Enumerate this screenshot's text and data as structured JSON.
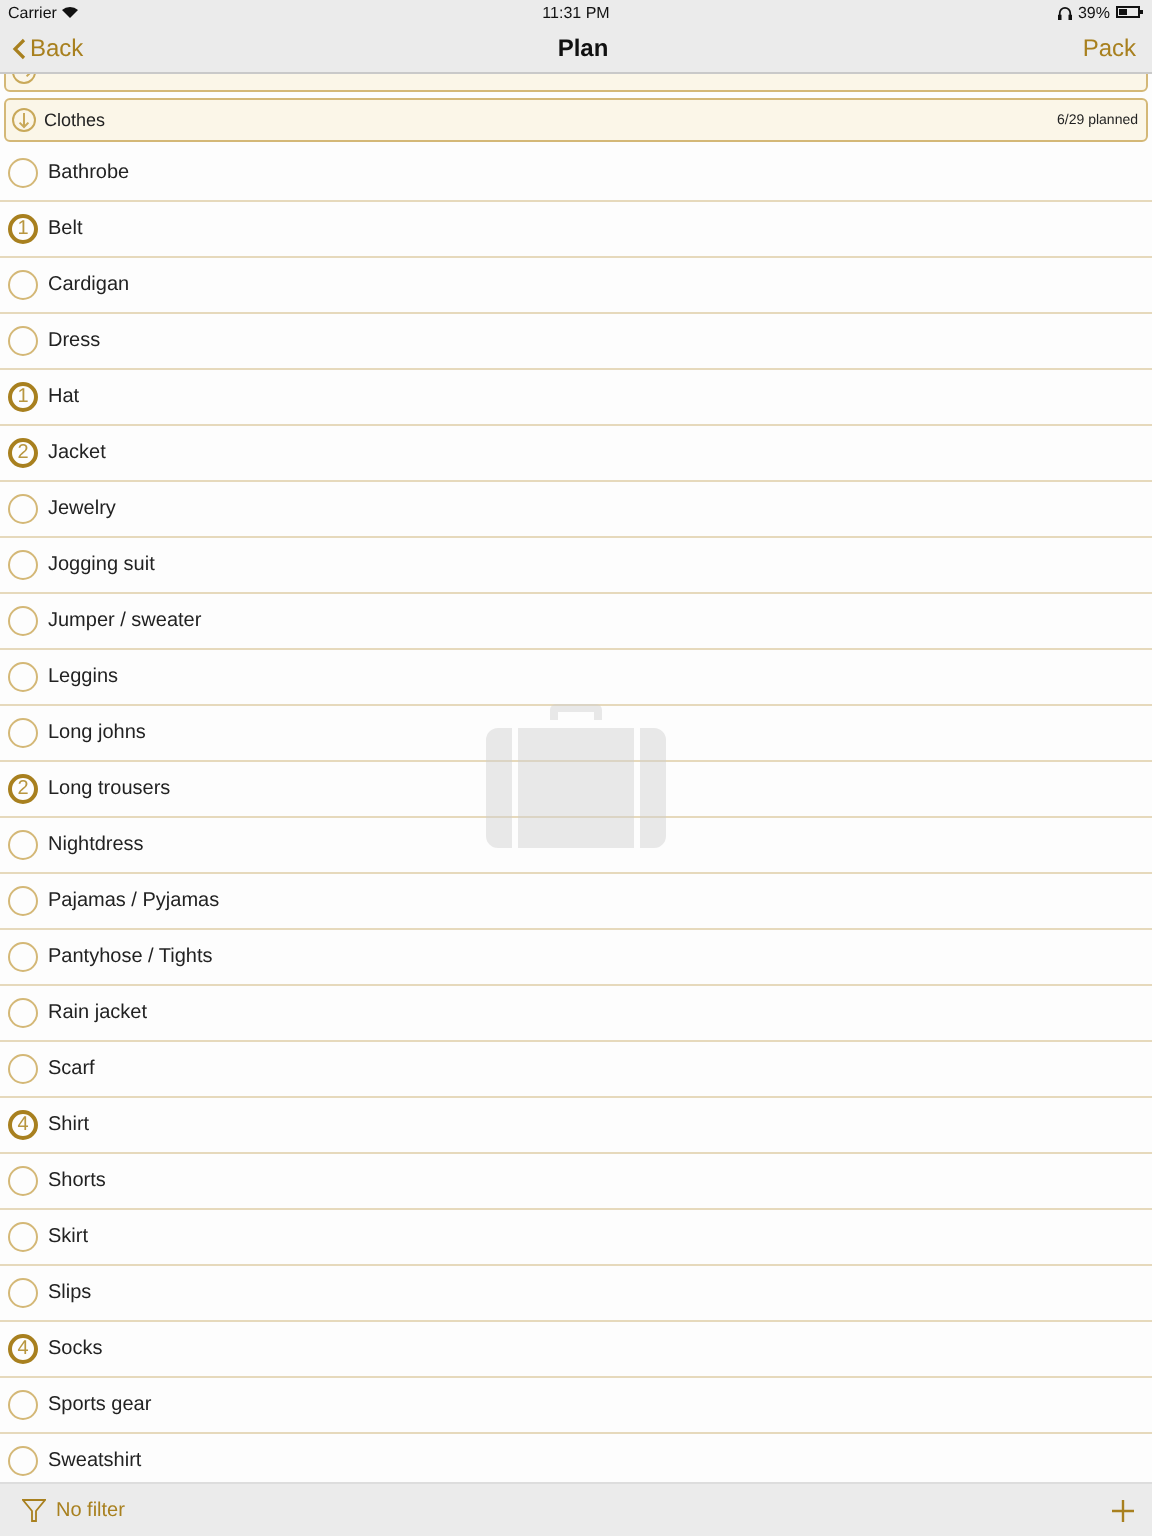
{
  "status_bar": {
    "carrier": "Carrier",
    "time": "11:31 PM",
    "battery": "39%"
  },
  "nav": {
    "back": "Back",
    "title": "Plan",
    "action": "Pack"
  },
  "sections": [
    {
      "expanded": false
    },
    {
      "title": "Clothes",
      "expanded": true,
      "summary": "6/29 planned"
    }
  ],
  "items": [
    {
      "name": "Bathrobe",
      "planned": false
    },
    {
      "name": "Belt",
      "planned": true,
      "count": "1"
    },
    {
      "name": "Cardigan",
      "planned": false
    },
    {
      "name": "Dress",
      "planned": false
    },
    {
      "name": "Hat",
      "planned": true,
      "count": "1"
    },
    {
      "name": "Jacket",
      "planned": true,
      "count": "2"
    },
    {
      "name": "Jewelry",
      "planned": false
    },
    {
      "name": "Jogging suit",
      "planned": false
    },
    {
      "name": "Jumper / sweater",
      "planned": false
    },
    {
      "name": "Leggins",
      "planned": false
    },
    {
      "name": "Long johns",
      "planned": false
    },
    {
      "name": "Long trousers",
      "planned": true,
      "count": "2"
    },
    {
      "name": "Nightdress",
      "planned": false
    },
    {
      "name": "Pajamas / Pyjamas",
      "planned": false
    },
    {
      "name": "Pantyhose / Tights",
      "planned": false
    },
    {
      "name": "Rain jacket",
      "planned": false
    },
    {
      "name": "Scarf",
      "planned": false
    },
    {
      "name": "Shirt",
      "planned": true,
      "count": "4"
    },
    {
      "name": "Shorts",
      "planned": false
    },
    {
      "name": "Skirt",
      "planned": false
    },
    {
      "name": "Slips",
      "planned": false
    },
    {
      "name": "Socks",
      "planned": true,
      "count": "4"
    },
    {
      "name": "Sports gear",
      "planned": false
    },
    {
      "name": "Sweatshirt",
      "planned": false
    }
  ],
  "toolbar": {
    "filter": "No filter"
  }
}
